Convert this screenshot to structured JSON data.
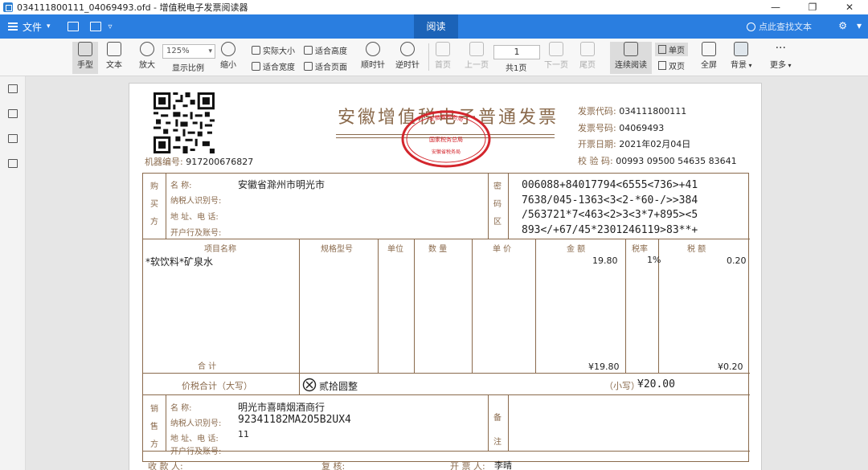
{
  "titlebar": {
    "title": "034111800111_04069493.ofd - 增值税电子发票阅读器",
    "minimize": "—",
    "restore": "❐",
    "close": "✕"
  },
  "menubar": {
    "file_label": "文件",
    "read_tab": "阅读",
    "search_placeholder": "点此查找文本"
  },
  "toolbar": {
    "hand": "手型",
    "text": "文本",
    "zoom_in": "放大",
    "zoom_value": "125%",
    "zoom_ratio": "显示比例",
    "zoom_out": "缩小",
    "actual_size": "实际大小",
    "fit_width": "适合宽度",
    "fit_height": "适合高度",
    "fit_page": "适合页面",
    "rotate_cw": "顺时针",
    "rotate_ccw": "逆时针",
    "first_page": "首页",
    "prev_page": "上一页",
    "page_number": "1",
    "total_pages": "共1页",
    "next_page": "下一页",
    "last_page": "尾页",
    "continuous": "连续阅读",
    "single": "单页",
    "double": "双页",
    "fullscreen": "全屏",
    "background": "背景",
    "more": "更多",
    "more_dots": "···"
  },
  "invoice": {
    "title": "安徽增值税电子普通发票",
    "seal_outer": "安徽省税务局",
    "seal_middle": "国家税务总局",
    "seal_inner": "安徽省税务局",
    "code_label": "发票代码:",
    "code": "034111800111",
    "number_label": "发票号码:",
    "number": "04069493",
    "date_label": "开票日期:",
    "date": "2021年02月04日",
    "check_label": "校 验 码:",
    "check": "00993 09500 54635 83641",
    "machine_label": "机器编号:",
    "machine": "917200676827",
    "buyer_label": [
      "购",
      "买",
      "方"
    ],
    "buyer_name_label": "名        称:",
    "buyer_name": "安徽省滁州市明光市",
    "buyer_tax_label": "纳税人识别号:",
    "buyer_addr_label": "地 址、电 话:",
    "buyer_bank_label": "开户行及账号:",
    "cipher_label": [
      "密",
      "码",
      "区"
    ],
    "cipher": [
      "006088+84017794<6555<736>+41",
      "7638/045-1363<3<2-*60-/>>384",
      "/563721*7<463<2>3<3*7+895><5",
      "893</+67/45*2301246119>83**+"
    ],
    "col_item": "项目名称",
    "col_spec": "规格型号",
    "col_unit": "单位",
    "col_qty": "数  量",
    "col_price": "单  价",
    "col_amount": "金  额",
    "col_rate": "税率",
    "col_tax": "税  额",
    "item_name": "*软饮料*矿泉水",
    "item_amount": "19.80",
    "item_rate": "1%",
    "item_tax": "0.20",
    "total_label": "合        计",
    "total_amount": "¥19.80",
    "total_tax": "¥0.20",
    "grand_label": "价税合计（大写）",
    "grand_upper": "贰拾圆整",
    "grand_lower_label": "（小写）",
    "grand_lower": "¥20.00",
    "seller_label": [
      "销",
      "售",
      "方"
    ],
    "seller_name_label": "名        称:",
    "seller_name": "明光市喜晴烟酒商行",
    "seller_tax_label": "纳税人识别号:",
    "seller_tax": "92341182MA2O5B2UX4",
    "seller_addr_label": "地 址、电 话:",
    "seller_addr": "11",
    "seller_bank_label": "开户行及账号:",
    "remark_label": [
      "备",
      "注"
    ],
    "payee_label": "收 款 人:",
    "reviewer_label": "复   核:",
    "issuer_label": "开 票 人:",
    "issuer": "李晴"
  }
}
